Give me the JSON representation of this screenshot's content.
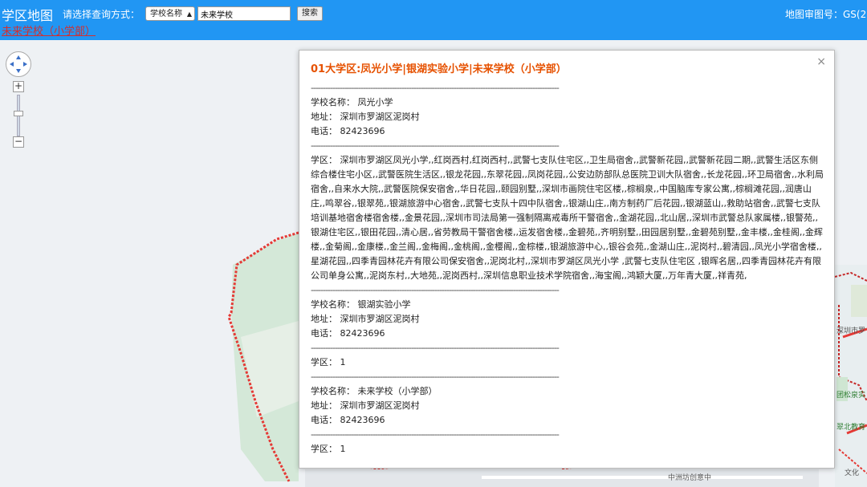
{
  "header": {
    "title": "学区地图",
    "query_label": "请选择查询方式：",
    "select_value": "学校名称",
    "search_value": "未来学校",
    "search_button": "搜索",
    "map_approval": "地图审图号：GS(2"
  },
  "result_link": "未来学校（小学部）",
  "map_labels": {
    "label1": "团松泉实",
    "label2": "翠北教育",
    "label3": "深圳市罗",
    "label4": "中洲坊创意中",
    "label5": "文化"
  },
  "colors": {
    "topbar": "#2196f3",
    "title_orange": "#e65100",
    "link_red": "#d32f2f",
    "boundary_red": "#e53935"
  },
  "popup": {
    "title": "01大学区:凤光小学|银湖实验小学|未来学校（小学部）",
    "divider": "--------------------------------------------------------------------------------------------------------",
    "school1": {
      "name_line": "学校名称：  凤光小学",
      "address_line": "地址：  深圳市罗湖区泥岗村",
      "phone_line": "电话：  82423696"
    },
    "district1": "学区：  深圳市罗湖区凤光小学,,红岗西村,红岗西村,,武警七支队住宅区,,卫生局宿舍,,武警新花园,,武警新花园二期,,武警生活区东侧综合楼住宅小区,,武警医院生活区,,银龙花园,,东翠花园,,凤岗花园,,公安边防部队总医院卫训大队宿舍,,长龙花园,,环卫局宿舍,,水利局宿舍,,自来水大院,,武警医院保安宿舍,,华日花园,,颐园别墅,,深圳市画院住宅区楼,,棕榈泉,,中国脑库专家公寓,,棕榈滩花园,,润唐山庄,,鸣翠谷,,银翠苑,,银湖旅游中心宿舍,,武警七支队十四中队宿舍,,银湖山庄,,南方制药厂后花园,,银湖蓝山,,救助站宿舍,,武警七支队培训基地宿舍楼宿舍楼,,金景花园,,深圳市司法局第一强制隔离戒毒所干警宿舍,,金湖花园,,北山居,,深圳市武警总队家属楼,,银警苑,,银湖住宅区,,银田花园,,清心居,,省劳教局干警宿舍楼,,运发宿舍楼,,金碧苑,,齐明别墅,,田园居别墅,,金碧苑别墅,,金丰楼,,金桂阁,,金辉楼,,金菊阁,,金康楼,,金兰阁,,金梅阁,,金桃阁,,金樱阁,,金棕楼,,银湖旅游中心,,银谷会苑,,金湖山庄,,泥岗村,,碧清园,,凤光小学宿舍楼,,星湖花园,,四季青园林花卉有限公司保安宿舍,,泥岗北村,,深圳市罗湖区凤光小学 ,武警七支队住宅区 ,银晖名居,,四季青园林花卉有限公司单身公寓,,泥岗东村,,大地苑,,泥岗西村,,深圳信息职业技术学院宿舍,,海宝阁,,鸿颖大厦,,万年青大厦,,祥青苑,",
    "school2": {
      "name_line": "学校名称：  银湖实验小学",
      "address_line": "地址：  深圳市罗湖区泥岗村",
      "phone_line": "电话：  82423696"
    },
    "district2": "学区：  1",
    "school3": {
      "name_line": "学校名称：  未来学校（小学部）",
      "address_line": "地址：  深圳市罗湖区泥岗村",
      "phone_line": "电话：  82423696"
    },
    "district3": "学区：  1",
    "close_symbol": "×"
  }
}
